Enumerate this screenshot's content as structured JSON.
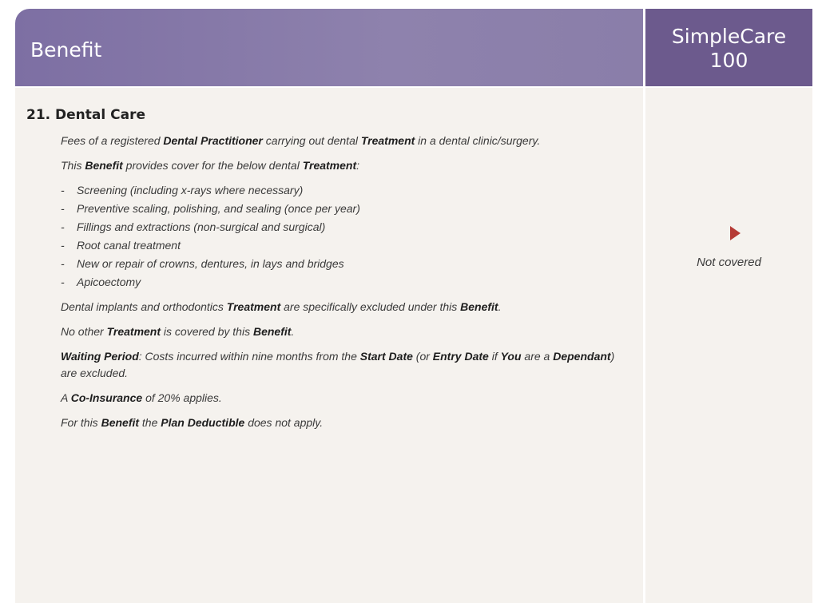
{
  "header": {
    "benefit_label": "Benefit",
    "plan_line1": "SimpleCare",
    "plan_line2": "100"
  },
  "section": {
    "title": "21. Dental Care",
    "intro": {
      "t1": "Fees of a registered ",
      "b1": "Dental Practitioner",
      "t2": " carrying out dental ",
      "b2": "Treatment",
      "t3": " in a dental clinic/surgery."
    },
    "cover_line": {
      "t1": "This ",
      "b1": "Benefit",
      "t2": " provides cover for the below dental ",
      "b2": "Treatment",
      "t3": ":"
    },
    "list_dash": "-",
    "list": [
      "Screening (including x-rays where necessary)",
      "Preventive scaling, polishing, and sealing (once per year)",
      "Fillings and extractions (non-surgical and surgical)",
      "Root canal treatment",
      "New or repair of crowns, dentures, in lays and bridges",
      "Apicoectomy"
    ],
    "exclusion": {
      "t1": "Dental implants and orthodontics ",
      "b1": "Treatment",
      "t2": " are specifically excluded under this ",
      "b2": "Benefit",
      "t3": "."
    },
    "no_other": {
      "t1": "No other ",
      "b1": "Treatment",
      "t2": " is covered by this ",
      "b2": "Benefit",
      "t3": "."
    },
    "waiting": {
      "b1": "Waiting Period",
      "t1": ": Costs incurred within nine months from the ",
      "b2": "Start Date",
      "t2": " (or ",
      "b3": "Entry Date",
      "t3": " if ",
      "b4": "You",
      "t4": " are a ",
      "b5": "Dependant",
      "t5": ") are excluded."
    },
    "coinsurance": {
      "t1": "A ",
      "b1": "Co-Insurance",
      "t2": " of 20% applies."
    },
    "deductible": {
      "t1": "For this ",
      "b1": "Benefit",
      "t2": " the ",
      "b2": "Plan Deductible",
      "t3": " does not apply."
    }
  },
  "plan_cell": {
    "status": "Not covered",
    "status_icon": "triangle-right-icon",
    "icon_color": "#b53a35"
  },
  "colors": {
    "header_benefit": "#8a7ea9",
    "header_plan": "#6c5a8d",
    "body_bg": "#f5f2ee"
  }
}
